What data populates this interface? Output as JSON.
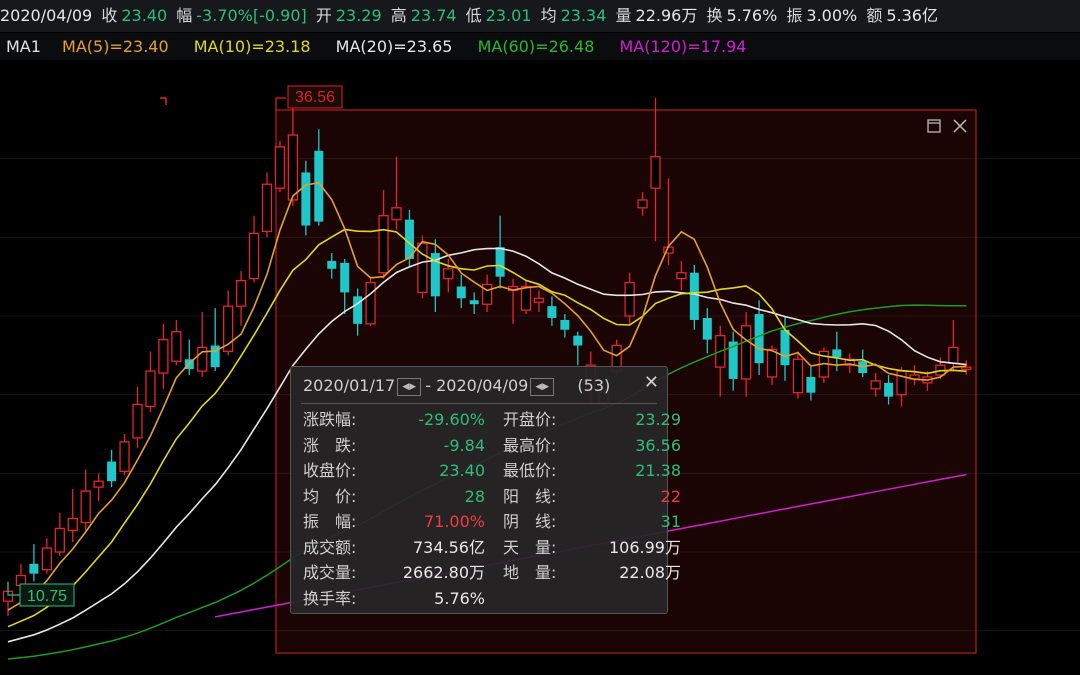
{
  "header": {
    "date": "2020/04/09",
    "close_label": "收",
    "close_value": "23.40",
    "change_label": "幅",
    "change_value": "-3.70%[-0.90]",
    "open_label": "开",
    "open_value": "23.29",
    "high_label": "高",
    "high_value": "23.74",
    "low_label": "低",
    "low_value": "23.01",
    "avg_label": "均",
    "avg_value": "23.34",
    "volume_label": "量",
    "volume_value": "22.96万",
    "turnover_label": "换",
    "turnover_value": "5.76%",
    "amplitude_label": "振",
    "amplitude_value": "3.00%",
    "amount_label": "额",
    "amount_value": "5.36亿"
  },
  "ma_bar": {
    "name": "MA1",
    "ma5": "MA(5)=23.40",
    "ma10": "MA(10)=23.18",
    "ma20": "MA(20)=23.65",
    "ma60": "MA(60)=26.48",
    "ma120": "MA(120)=17.94"
  },
  "colors": {
    "up": "#e8232a",
    "down": "#20c7c9",
    "ma5": "#e6a12a",
    "ma10": "#e0d81e",
    "ma20": "#e6e6e6",
    "ma60": "#1c9e1c",
    "ma120": "#d21ed2",
    "selection": "#e02020"
  },
  "chart_data": {
    "type": "candlestick",
    "price_range": [
      8,
      38
    ],
    "high_marker": "36.56",
    "low_marker": "10.75",
    "candles": [
      {
        "o": 11.5,
        "c": 12.0,
        "h": 12.5,
        "l": 10.75
      },
      {
        "o": 12.3,
        "c": 12.8,
        "h": 13.4,
        "l": 12.0
      },
      {
        "o": 13.4,
        "c": 12.9,
        "h": 14.4,
        "l": 12.5
      },
      {
        "o": 13.1,
        "c": 14.2,
        "h": 14.7,
        "l": 12.9
      },
      {
        "o": 14.0,
        "c": 15.2,
        "h": 16.0,
        "l": 13.8
      },
      {
        "o": 15.1,
        "c": 15.7,
        "h": 17.2,
        "l": 14.5
      },
      {
        "o": 15.5,
        "c": 17.1,
        "h": 18.2,
        "l": 15.1
      },
      {
        "o": 17.3,
        "c": 17.6,
        "h": 18.0,
        "l": 16.6
      },
      {
        "o": 18.6,
        "c": 17.6,
        "h": 19.2,
        "l": 17.3
      },
      {
        "o": 18.1,
        "c": 19.6,
        "h": 20.0,
        "l": 17.9
      },
      {
        "o": 19.8,
        "c": 21.5,
        "h": 22.4,
        "l": 19.3
      },
      {
        "o": 21.4,
        "c": 23.2,
        "h": 24.2,
        "l": 21.1
      },
      {
        "o": 23.1,
        "c": 24.8,
        "h": 25.6,
        "l": 22.3
      },
      {
        "o": 23.7,
        "c": 25.2,
        "h": 25.8,
        "l": 23.5
      },
      {
        "o": 23.8,
        "c": 23.3,
        "h": 24.8,
        "l": 23.0
      },
      {
        "o": 23.2,
        "c": 24.4,
        "h": 26.2,
        "l": 22.9
      },
      {
        "o": 24.5,
        "c": 23.4,
        "h": 26.4,
        "l": 23.2
      },
      {
        "o": 24.2,
        "c": 26.5,
        "h": 27.3,
        "l": 24.0
      },
      {
        "o": 26.5,
        "c": 27.8,
        "h": 28.3,
        "l": 25.5
      },
      {
        "o": 27.9,
        "c": 30.2,
        "h": 31.1,
        "l": 27.7
      },
      {
        "o": 30.3,
        "c": 32.7,
        "h": 33.3,
        "l": 30.0
      },
      {
        "o": 32.5,
        "c": 34.6,
        "h": 34.9,
        "l": 32.3
      },
      {
        "o": 31.9,
        "c": 35.2,
        "h": 36.56,
        "l": 31.6
      },
      {
        "o": 33.3,
        "c": 30.6,
        "h": 33.9,
        "l": 30.1
      },
      {
        "o": 34.4,
        "c": 30.8,
        "h": 35.5,
        "l": 30.6
      },
      {
        "o": 28.8,
        "c": 28.4,
        "h": 29.2,
        "l": 27.9
      },
      {
        "o": 28.7,
        "c": 27.2,
        "h": 28.9,
        "l": 26.1
      },
      {
        "o": 27.0,
        "c": 25.6,
        "h": 27.4,
        "l": 25.0
      },
      {
        "o": 25.6,
        "c": 27.7,
        "h": 28.0,
        "l": 25.5
      },
      {
        "o": 28.2,
        "c": 31.1,
        "h": 32.4,
        "l": 27.9
      },
      {
        "o": 30.9,
        "c": 31.5,
        "h": 34.1,
        "l": 30.4
      },
      {
        "o": 30.9,
        "c": 28.9,
        "h": 31.4,
        "l": 28.5
      },
      {
        "o": 27.2,
        "c": 29.7,
        "h": 30.1,
        "l": 26.9
      },
      {
        "o": 29.2,
        "c": 27.0,
        "h": 29.9,
        "l": 26.2
      },
      {
        "o": 27.9,
        "c": 28.4,
        "h": 28.9,
        "l": 27.2
      },
      {
        "o": 27.5,
        "c": 26.9,
        "h": 28.1,
        "l": 26.4
      },
      {
        "o": 26.8,
        "c": 26.6,
        "h": 27.2,
        "l": 26.1
      },
      {
        "o": 26.6,
        "c": 27.6,
        "h": 28.1,
        "l": 26.2
      },
      {
        "o": 29.5,
        "c": 28.0,
        "h": 31.1,
        "l": 27.4
      },
      {
        "o": 27.3,
        "c": 27.5,
        "h": 27.9,
        "l": 25.6
      },
      {
        "o": 26.3,
        "c": 27.5,
        "h": 27.8,
        "l": 26.1
      },
      {
        "o": 26.7,
        "c": 26.9,
        "h": 27.3,
        "l": 26.2
      },
      {
        "o": 26.5,
        "c": 25.9,
        "h": 27.0,
        "l": 25.5
      },
      {
        "o": 25.8,
        "c": 25.3,
        "h": 26.1,
        "l": 24.9
      },
      {
        "o": 25.0,
        "c": 24.5,
        "h": 25.2,
        "l": 23.5
      },
      {
        "o": 22.3,
        "c": 23.5,
        "h": 24.2,
        "l": 21.4
      },
      {
        "o": 21.6,
        "c": 22.1,
        "h": 22.5,
        "l": 21.4
      },
      {
        "o": 23.2,
        "c": 24.5,
        "h": 24.8,
        "l": 22.9
      },
      {
        "o": 26.0,
        "c": 27.7,
        "h": 28.2,
        "l": 25.6
      },
      {
        "o": 31.5,
        "c": 31.9,
        "h": 32.3,
        "l": 31.1
      },
      {
        "o": 32.5,
        "c": 34.1,
        "h": 37.1,
        "l": 29.8
      },
      {
        "o": 29.2,
        "c": 29.5,
        "h": 33.0,
        "l": 28.6
      },
      {
        "o": 27.9,
        "c": 28.2,
        "h": 28.8,
        "l": 27.3
      },
      {
        "o": 28.2,
        "c": 25.8,
        "h": 28.6,
        "l": 25.3
      },
      {
        "o": 25.9,
        "c": 24.8,
        "h": 26.4,
        "l": 24.1
      },
      {
        "o": 23.4,
        "c": 25.0,
        "h": 25.5,
        "l": 21.9
      },
      {
        "o": 24.7,
        "c": 22.8,
        "h": 25.2,
        "l": 22.2
      },
      {
        "o": 22.8,
        "c": 25.5,
        "h": 26.2,
        "l": 21.9
      },
      {
        "o": 26.1,
        "c": 23.6,
        "h": 26.8,
        "l": 23.0
      },
      {
        "o": 22.9,
        "c": 24.3,
        "h": 24.5,
        "l": 22.5
      },
      {
        "o": 25.3,
        "c": 23.5,
        "h": 26.0,
        "l": 22.7
      },
      {
        "o": 22.1,
        "c": 23.8,
        "h": 24.2,
        "l": 21.8
      },
      {
        "o": 22.9,
        "c": 22.1,
        "h": 23.4,
        "l": 21.7
      },
      {
        "o": 22.9,
        "c": 24.2,
        "h": 24.4,
        "l": 22.6
      },
      {
        "o": 24.3,
        "c": 23.9,
        "h": 25.2,
        "l": 23.2
      },
      {
        "o": 23.5,
        "c": 23.8,
        "h": 24.1,
        "l": 23.1
      },
      {
        "o": 23.7,
        "c": 23.1,
        "h": 24.3,
        "l": 22.9
      },
      {
        "o": 22.3,
        "c": 22.7,
        "h": 23.1,
        "l": 21.9
      },
      {
        "o": 22.6,
        "c": 21.9,
        "h": 23.0,
        "l": 21.5
      },
      {
        "o": 22.0,
        "c": 23.2,
        "h": 23.4,
        "l": 21.4
      },
      {
        "o": 22.8,
        "c": 23.0,
        "h": 23.5,
        "l": 22.5
      },
      {
        "o": 22.6,
        "c": 22.9,
        "h": 23.2,
        "l": 22.2
      },
      {
        "o": 23.0,
        "c": 23.5,
        "h": 23.9,
        "l": 22.8
      },
      {
        "o": 23.6,
        "c": 24.4,
        "h": 25.8,
        "l": 23.2
      },
      {
        "o": 23.29,
        "c": 23.4,
        "h": 23.74,
        "l": 23.01
      }
    ]
  },
  "selection": {
    "from_date": "2020/01/17",
    "to_date": "2020/04/09",
    "dash": "-",
    "count": "(53)",
    "left": [
      {
        "label": "涨跌幅:",
        "value": "-29.60%",
        "color": "green"
      },
      {
        "label": "涨　跌:",
        "value": "-9.84",
        "color": "green"
      },
      {
        "label": "收盘价:",
        "value": "23.40",
        "color": "green"
      },
      {
        "label": "均　价:",
        "value": "28",
        "color": "green"
      },
      {
        "label": "振　幅:",
        "value": "71.00%",
        "color": "red"
      },
      {
        "label": "成交额:",
        "value": "734.56亿",
        "color": "white"
      },
      {
        "label": "成交量:",
        "value": "2662.80万",
        "color": "white"
      },
      {
        "label": "换手率:",
        "value": "5.76%",
        "color": "white"
      }
    ],
    "right": [
      {
        "label": "开盘价:",
        "value": "23.29",
        "color": "green"
      },
      {
        "label": "最高价:",
        "value": "36.56",
        "color": "green"
      },
      {
        "label": "最低价:",
        "value": "21.38",
        "color": "green"
      },
      {
        "label": "阳　线:",
        "value": "22",
        "color": "red"
      },
      {
        "label": "阴　线:",
        "value": "31",
        "color": "green"
      },
      {
        "label": "天　量:",
        "value": "106.99万",
        "color": "white"
      },
      {
        "label": "地　量:",
        "value": "22.08万",
        "color": "white"
      }
    ]
  }
}
